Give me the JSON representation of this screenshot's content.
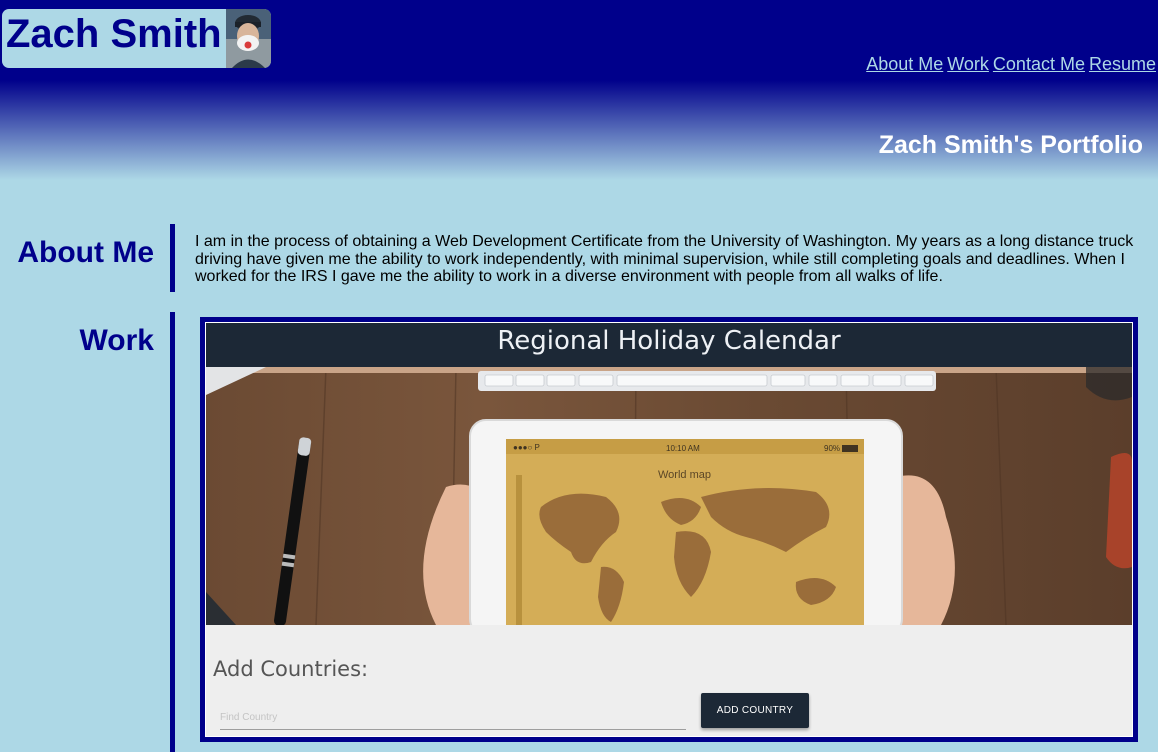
{
  "header": {
    "name": "Zach Smith",
    "subtitle": "Zach Smith's Portfolio",
    "nav": [
      "About Me",
      "Work",
      "Contact Me",
      "Resume"
    ]
  },
  "about": {
    "heading": "About Me",
    "text": "I am in the process of obtaining a Web Development Certificate from the University of Washington. My years as a long distance truck driving have given me the ability to work independently, with minimal supervision, while still completing goals and deadlines. When I worked for the IRS I gave me the ability to work in a diverse environment with people from all walks of life."
  },
  "work": {
    "heading": "Work",
    "project": {
      "title": "Regional Holiday Calendar",
      "tablet_status_time": "10:10 AM",
      "tablet_status_battery": "90%",
      "tablet_screen_title": "World map",
      "form_title": "Add Countries:",
      "input_placeholder": "Find Country",
      "button_label": "ADD COUNTRY"
    }
  },
  "colors": {
    "primary": "#00008b",
    "background": "#add8e6",
    "nav_link": "#add8e6",
    "project_header": "#1c2836"
  }
}
